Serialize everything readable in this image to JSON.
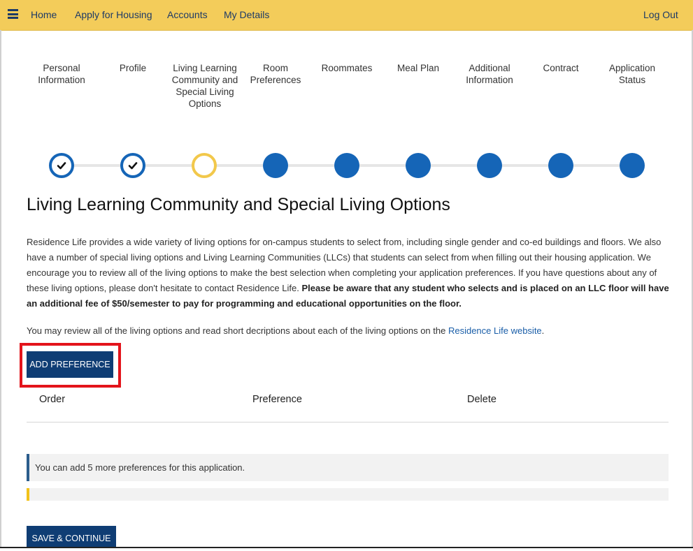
{
  "nav": {
    "links": [
      "Home",
      "Apply for Housing",
      "Accounts",
      "My Details"
    ],
    "logout": "Log Out",
    "bar_color": "#f3cc5a"
  },
  "steps": [
    {
      "label": "Personal Information",
      "state": "done"
    },
    {
      "label": "Profile",
      "state": "done"
    },
    {
      "label": "Living Learning Community and Special Living Options",
      "state": "current"
    },
    {
      "label": "Room Preferences",
      "state": "todo"
    },
    {
      "label": "Roommates",
      "state": "todo"
    },
    {
      "label": "Meal Plan",
      "state": "todo"
    },
    {
      "label": "Additional Information",
      "state": "todo"
    },
    {
      "label": "Contract",
      "state": "todo"
    },
    {
      "label": "Application Status",
      "state": "todo"
    }
  ],
  "page": {
    "title": "Living Learning Community and Special Living Options",
    "intro_text": "Residence Life provides a wide variety of living options for on-campus students to select from, including single gender and co-ed buildings and floors. We also have a number of special living options and Living Learning Communities (LLCs) that students can select from when filling out their housing application. We encourage you to review all of the living options to make the best selection when completing your application preferences. If you have questions about any of these living options, please don't hesitate to contact Residence Life.",
    "intro_bold": "Please be aware that any student who selects and is placed on an LLC floor will have an additional fee of $50/semester to pay for programming and educational opportunities on the floor.",
    "review_text": "You may review all of the living options and read short decriptions about each of the living options on the",
    "review_link": "Residence Life website",
    "review_end": ".",
    "add_button": "ADD PREFERENCE",
    "table_headers": {
      "order": "Order",
      "preference": "Preference",
      "delete": "Delete"
    },
    "alert_text": "You can add 5 more preferences for this application.",
    "save_button": "SAVE & CONTINUE"
  },
  "colors": {
    "primary": "#0f3d74",
    "step_blue": "#1565b7",
    "step_current": "#f2c84b",
    "highlight": "#e3141b"
  }
}
